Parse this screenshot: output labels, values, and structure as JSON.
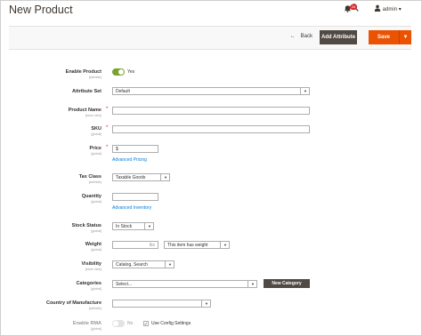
{
  "header": {
    "title": "New Product",
    "notification_count": "26",
    "user_name": "admin",
    "search_icon": "search-icon",
    "bell_icon": "bell-icon",
    "user_icon": "user-icon"
  },
  "actions": {
    "back_label": "Back",
    "add_attribute_label": "Add Attribute",
    "save_label": "Save"
  },
  "form": {
    "enable_product": {
      "label": "Enable Product",
      "scope": "[website]",
      "value": "Yes"
    },
    "attribute_set": {
      "label": "Attribute Set",
      "value": "Default"
    },
    "product_name": {
      "label": "Product Name",
      "scope": "[store view]",
      "value": ""
    },
    "sku": {
      "label": "SKU",
      "scope": "[global]",
      "value": ""
    },
    "price": {
      "label": "Price",
      "scope": "[global]",
      "currency": "$",
      "value": "",
      "advanced_link": "Advanced Pricing"
    },
    "tax_class": {
      "label": "Tax Class",
      "scope": "[website]",
      "value": "Taxable Goods"
    },
    "quantity": {
      "label": "Quantity",
      "scope": "[global]",
      "value": "",
      "advanced_link": "Advanced Inventory"
    },
    "stock_status": {
      "label": "Stock Status",
      "scope": "[global]",
      "value": "In Stock"
    },
    "weight": {
      "label": "Weight",
      "scope": "[global]",
      "unit": "lbs",
      "value": "",
      "has_weight": "This item has weight"
    },
    "visibility": {
      "label": "Visibility",
      "scope": "[store view]",
      "value": "Catalog, Search"
    },
    "categories": {
      "label": "Categories",
      "scope": "[global]",
      "placeholder": "Select...",
      "new_category_label": "New Category"
    },
    "country_of_manufacture": {
      "label": "Country of Manufacture",
      "scope": "[website]",
      "value": ""
    },
    "enable_rma": {
      "label": "Enable RMA",
      "scope": "[global]",
      "value": "No",
      "use_config_label": "Use Config Settings"
    }
  },
  "colors": {
    "accent": "#eb5202",
    "dark_button": "#514943",
    "toggle_on": "#79a22e",
    "link": "#007bdb"
  }
}
